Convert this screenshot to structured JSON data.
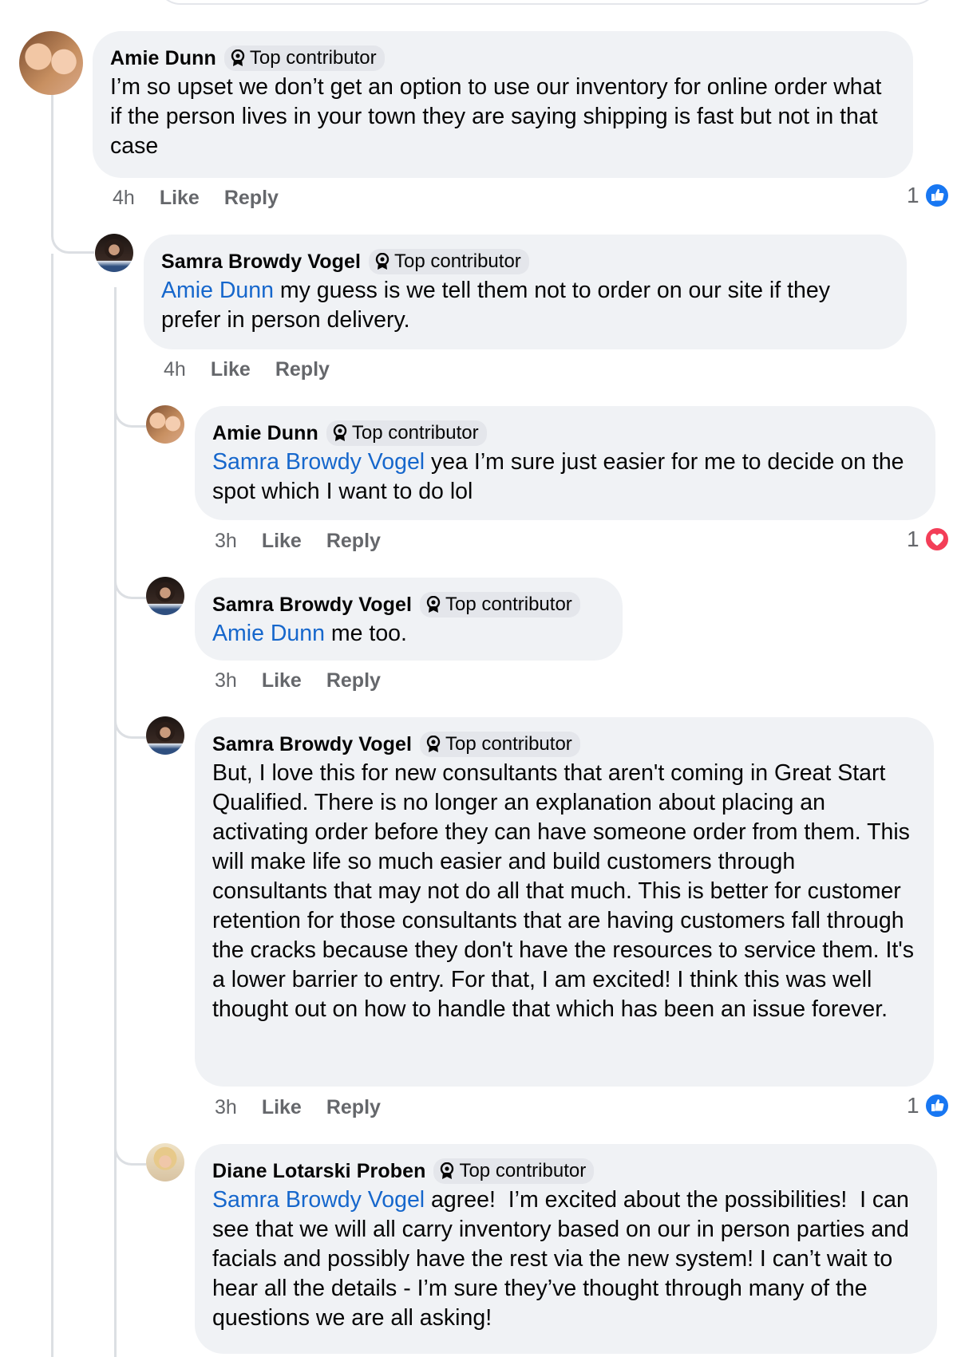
{
  "badge_label": "Top contributor",
  "colors": {
    "bubble": "#f0f2f5",
    "mention": "#1667cc",
    "meta": "#65676b",
    "like_blue": "#1877f2",
    "love_red": "#f33e58"
  },
  "comments": [
    {
      "author": "Amie Dunn",
      "mention": "",
      "text": "I’m so upset we don’t get an option to use our inventory for online order what if the person lives in your town they are saying shipping is fast but not in that case",
      "time": "4h",
      "like": "Like",
      "reply": "Reply",
      "reaction_count": "1",
      "reaction": "like-icon"
    },
    {
      "author": "Samra Browdy Vogel",
      "mention": "Amie Dunn",
      "text": " my guess is we tell them not to order on our site if they prefer in person delivery.",
      "time": "4h",
      "like": "Like",
      "reply": "Reply"
    },
    {
      "author": "Amie Dunn",
      "mention": "Samra Browdy Vogel",
      "text": " yea I’m sure just easier for me to decide on the spot which I want to do lol",
      "time": "3h",
      "like": "Like",
      "reply": "Reply",
      "reaction_count": "1",
      "reaction": "love-icon"
    },
    {
      "author": "Samra Browdy Vogel",
      "mention": "Amie Dunn",
      "text": " me too.",
      "time": "3h",
      "like": "Like",
      "reply": "Reply"
    },
    {
      "author": "Samra Browdy Vogel",
      "mention": "",
      "text": "But, I love this for new consultants that aren't coming in Great Start Qualified. There is no longer an explanation about placing an activating order before they can have someone order from them. This will make life so much easier and build customers through consultants that may not do all that much. This is better for customer retention for those consultants that are having customers fall through the cracks because they don't have the resources to service them. It's a lower barrier to entry. For that, I am excited! I think this was well thought out on how to handle that which has been an issue forever.",
      "time": "3h",
      "like": "Like",
      "reply": "Reply",
      "reaction_count": "1",
      "reaction": "like-icon"
    },
    {
      "author": "Diane Lotarski Proben",
      "mention": "Samra Browdy Vogel",
      "text": " agree!  I’m excited about the possibilities!  I can see that we will all carry inventory based on our in person parties and facials and possibly have the rest via the new system! I can’t wait to hear all the details - I’m sure they’ve thought through many of the questions we are all asking!"
    }
  ]
}
